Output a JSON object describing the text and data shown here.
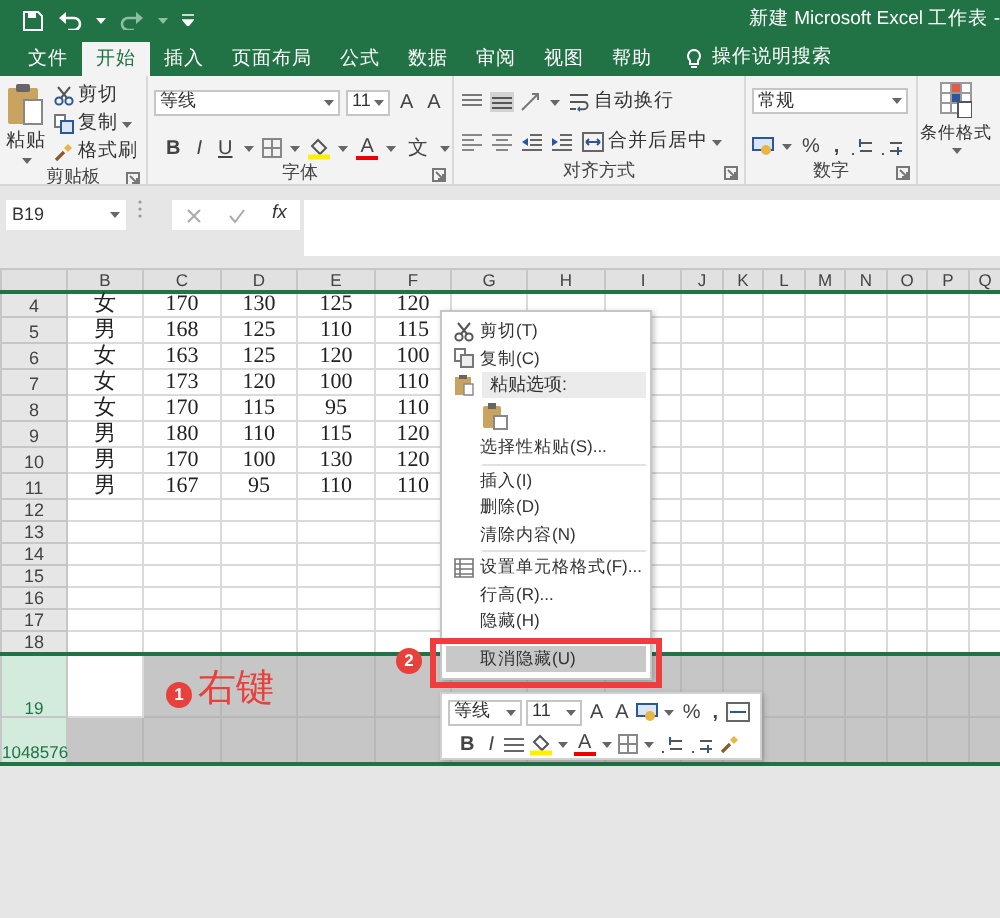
{
  "title_bar": {
    "title": "新建 Microsoft Excel 工作表 -"
  },
  "tabs": [
    {
      "label": "文件",
      "selected": false
    },
    {
      "label": "开始",
      "selected": true
    },
    {
      "label": "插入",
      "selected": false
    },
    {
      "label": "页面布局",
      "selected": false
    },
    {
      "label": "公式",
      "selected": false
    },
    {
      "label": "数据",
      "selected": false
    },
    {
      "label": "审阅",
      "selected": false
    },
    {
      "label": "视图",
      "selected": false
    },
    {
      "label": "帮助",
      "selected": false
    }
  ],
  "tell_me": "操作说明搜索",
  "ribbon": {
    "clipboard": {
      "paste": "粘贴",
      "cut": "剪切",
      "copy": "复制",
      "format_painter": "格式刷",
      "group": "剪贴板"
    },
    "font": {
      "font_name": "等线",
      "font_size": "11",
      "grow": "A",
      "shrink": "A",
      "bold": "B",
      "italic": "I",
      "underline": "U",
      "font_color": "A",
      "phonetic": "文",
      "group": "字体"
    },
    "alignment": {
      "wrap": "自动换行",
      "merge": "合并后居中",
      "group": "对齐方式"
    },
    "number": {
      "format": "常规",
      "percent": "%",
      "comma": ",",
      "group": "数字"
    },
    "styles": {
      "conditional": "条件格式"
    }
  },
  "formula_bar": {
    "name_box": "B19",
    "fx": "fx"
  },
  "columns": [
    "B",
    "C",
    "D",
    "E",
    "F",
    "G",
    "H",
    "I",
    "J",
    "K",
    "L",
    "M",
    "N",
    "O",
    "P",
    "Q"
  ],
  "rows": [
    {
      "header": "4",
      "cells": [
        "女",
        "170",
        "130",
        "125",
        "120"
      ],
      "selected": false,
      "active": false
    },
    {
      "header": "5",
      "cells": [
        "男",
        "168",
        "125",
        "110",
        "115"
      ],
      "selected": false,
      "active": false
    },
    {
      "header": "6",
      "cells": [
        "女",
        "163",
        "125",
        "120",
        "100"
      ],
      "selected": false,
      "active": false
    },
    {
      "header": "7",
      "cells": [
        "女",
        "173",
        "120",
        "100",
        "110"
      ],
      "selected": false,
      "active": false
    },
    {
      "header": "8",
      "cells": [
        "女",
        "170",
        "115",
        "95",
        "110"
      ],
      "selected": false,
      "active": false
    },
    {
      "header": "9",
      "cells": [
        "男",
        "180",
        "110",
        "115",
        "120"
      ],
      "selected": false,
      "active": false
    },
    {
      "header": "10",
      "cells": [
        "男",
        "170",
        "100",
        "130",
        "120"
      ],
      "selected": false,
      "active": false
    },
    {
      "header": "11",
      "cells": [
        "男",
        "167",
        "95",
        "110",
        "110"
      ],
      "selected": false,
      "active": false
    },
    {
      "header": "12",
      "selected": false,
      "active": false
    },
    {
      "header": "13",
      "selected": false,
      "active": false
    },
    {
      "header": "14",
      "selected": false,
      "active": false
    },
    {
      "header": "15",
      "selected": false,
      "active": false
    },
    {
      "header": "16",
      "selected": false,
      "active": false
    },
    {
      "header": "17",
      "selected": false,
      "active": false
    },
    {
      "header": "18",
      "selected": false,
      "active": false
    },
    {
      "header": "19",
      "selected": true,
      "active": true
    },
    {
      "header": "1048576",
      "selected": true,
      "active": false
    }
  ],
  "context_menu": [
    {
      "kind": "command",
      "label": "剪切(T)",
      "highlighted": false
    },
    {
      "kind": "command",
      "label": "复制(C)",
      "highlighted": false
    },
    {
      "kind": "header",
      "label": "粘贴选项:"
    },
    {
      "kind": "paste-options"
    },
    {
      "kind": "command",
      "label": "选择性粘贴(S)...",
      "highlighted": false
    },
    {
      "kind": "separator"
    },
    {
      "kind": "command",
      "label": "插入(I)",
      "highlighted": false
    },
    {
      "kind": "command",
      "label": "删除(D)",
      "highlighted": false
    },
    {
      "kind": "command",
      "label": "清除内容(N)",
      "highlighted": false
    },
    {
      "kind": "separator"
    },
    {
      "kind": "command",
      "label": "设置单元格格式(F)...",
      "highlighted": false
    },
    {
      "kind": "command",
      "label": "行高(R)...",
      "highlighted": false
    },
    {
      "kind": "command",
      "label": "隐藏(H)",
      "highlighted": false
    },
    {
      "kind": "command",
      "label": "取消隐藏(U)",
      "highlighted": true
    }
  ],
  "mini_toolbar": {
    "font_name": "等线",
    "font_size": "11",
    "grow": "A",
    "shrink": "A",
    "percent": "%",
    "comma": ",",
    "bold": "B",
    "italic": "I",
    "font_color": "A"
  },
  "annotations": [
    {
      "number": "1",
      "label": "右键"
    },
    {
      "number": "2"
    }
  ]
}
